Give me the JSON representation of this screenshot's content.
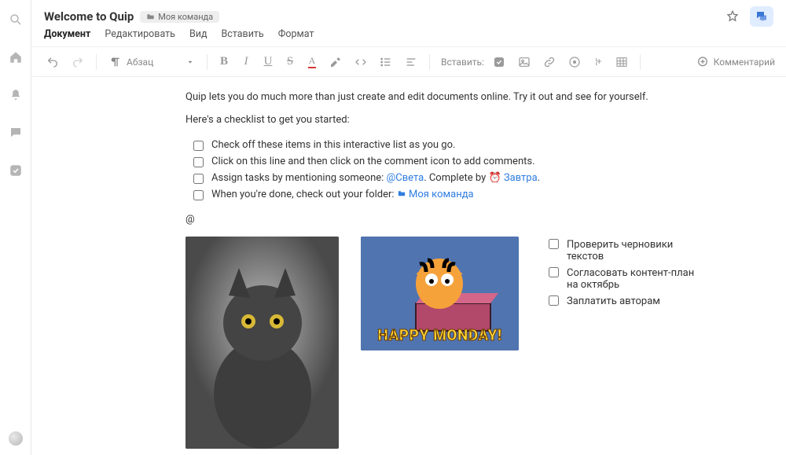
{
  "title": "Welcome to Quip",
  "folder_chip": "Моя команда",
  "menu": {
    "document": "Документ",
    "edit": "Редактировать",
    "view": "Вид",
    "insert": "Вставить",
    "format": "Формат"
  },
  "toolbar": {
    "paragraph_style": "Абзац",
    "insert_label": "Вставить:",
    "comment": "Комментарий"
  },
  "body": {
    "intro": "Quip lets you do much more than just create and edit documents online. Try it out and see for yourself.",
    "checklist_heading": "Here's a checklist to get you started:",
    "items": [
      {
        "text": "Check off these items in this interactive list as you go."
      },
      {
        "text": "Click on this line and then click on the comment icon to add comments."
      },
      {
        "prefix": "Assign tasks by mentioning someone: ",
        "mention": "@Света",
        "mid": ". Complete by ",
        "date": "Завтра",
        "suffix": "."
      },
      {
        "prefix": "When you're done, check out your folder: ",
        "link": "Моя команда"
      }
    ],
    "at": "@",
    "garfield_caption": "HAPPY MONDAY!",
    "side_tasks": [
      "Проверить черновики текстов",
      "Согласовать контент-план на октябрь",
      "Заплатить авторам"
    ]
  }
}
